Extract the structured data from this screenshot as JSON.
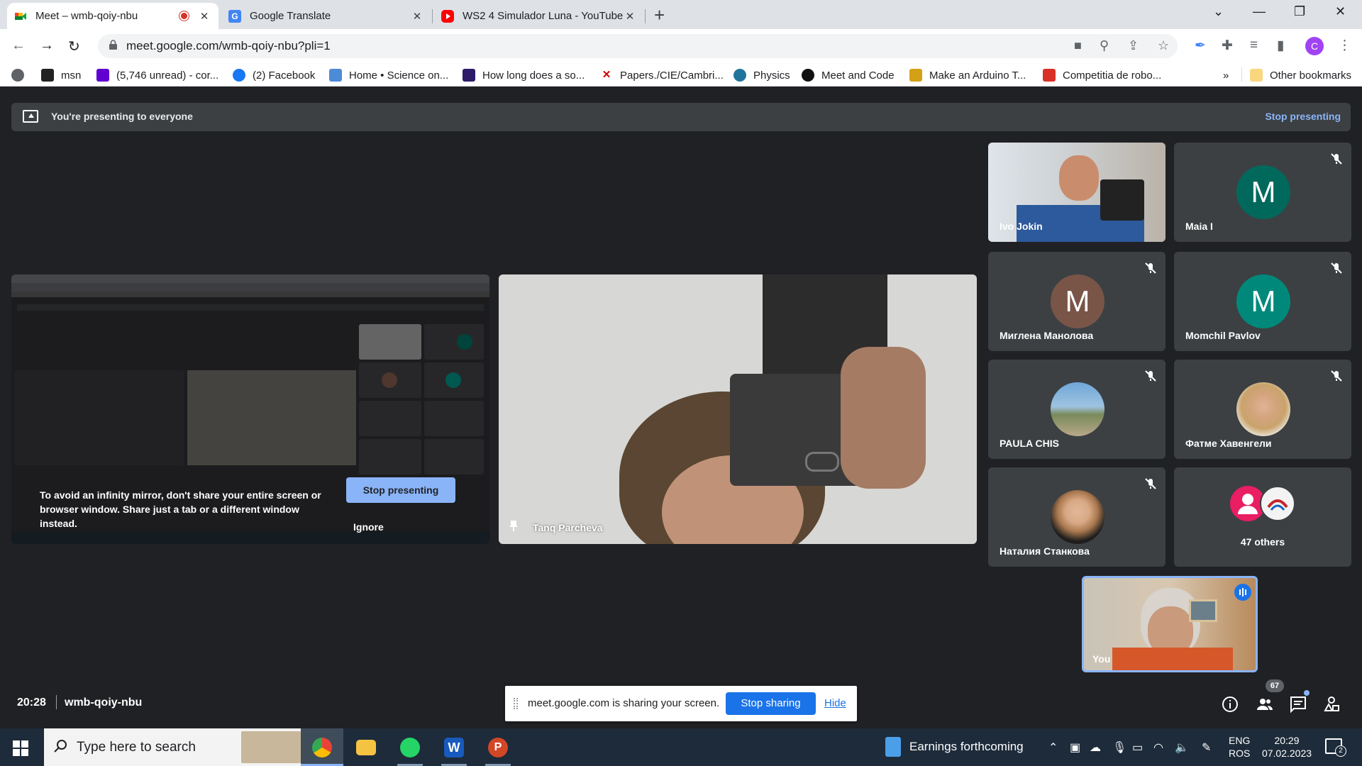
{
  "browser": {
    "tabs": [
      {
        "title": "Meet – wmb-qoiy-nbu",
        "icon": "google-meet-icon",
        "recording": true
      },
      {
        "title": "Google Translate",
        "icon": "google-translate-icon"
      },
      {
        "title": "WS2 4 Simulador Luna - YouTube",
        "icon": "youtube-icon"
      }
    ],
    "url": "meet.google.com/wmb-qoiy-nbu?pli=1",
    "profile_initial": "C",
    "bookmarks": [
      {
        "label": "msn",
        "icon": "msn-icon"
      },
      {
        "label": "(5,746 unread) - cor...",
        "icon": "yahoo-mail-icon"
      },
      {
        "label": "(2) Facebook",
        "icon": "facebook-icon"
      },
      {
        "label": "Home • Science on...",
        "icon": "bookmark-icon"
      },
      {
        "label": "How long does a so...",
        "icon": "bookmark-icon"
      },
      {
        "label": "Papers./CIE/Cambri...",
        "icon": "x-icon"
      },
      {
        "label": "Physics",
        "icon": "wordpress-icon"
      },
      {
        "label": "Meet and Code",
        "icon": "bookmark-icon"
      },
      {
        "label": "Make an Arduino T...",
        "icon": "bookmark-icon"
      },
      {
        "label": "Competitia de robo...",
        "icon": "bookmark-icon"
      }
    ],
    "overflow": "»",
    "other_bookmarks": "Other bookmarks"
  },
  "meet": {
    "banner_text": "You're presenting to everyone",
    "banner_stop": "Stop presenting",
    "mirror_warning": "To avoid an infinity mirror, don't share your entire screen or browser window. Share just a tab or a different window instead.",
    "mirror_stop": "Stop presenting",
    "mirror_ignore": "Ignore",
    "speaker_name": "Tanq Parcheva",
    "participants": [
      {
        "name": "Ivo Jokin",
        "type": "video"
      },
      {
        "name": "Maia I",
        "initial": "M",
        "color": "#00695c",
        "muted": true
      },
      {
        "name": "Миглена Манолова",
        "initial": "M",
        "color": "#795548",
        "muted": true
      },
      {
        "name": "Momchil Pavlov",
        "initial": "M",
        "color": "#00897b",
        "muted": true
      },
      {
        "name": "PAULA CHIS",
        "type": "photo",
        "muted": true
      },
      {
        "name": "Фатме Хавенгели",
        "type": "photo",
        "muted": true
      },
      {
        "name": "Наталия Станкова",
        "type": "photo",
        "muted": true
      }
    ],
    "others_label": "47 others",
    "self_label": "You",
    "time": "20:28",
    "meeting_code": "wmb-qoiy-nbu",
    "share_message": "meet.google.com is sharing your screen.",
    "share_stop": "Stop sharing",
    "share_hide": "Hide",
    "people_count": "67"
  },
  "taskbar": {
    "search_placeholder": "Type here to search",
    "news": "Earnings forthcoming",
    "lang_top": "ENG",
    "lang_bottom": "ROS",
    "time": "20:29",
    "date": "07.02.2023",
    "notification_count": "2",
    "apps": [
      "chrome-icon",
      "file-explorer-icon",
      "whatsapp-icon",
      "word-icon",
      "powerpoint-icon"
    ]
  },
  "colors": {
    "meet_bg": "#202124",
    "tile_bg": "#3c4043",
    "accent_blue": "#8ab4f8",
    "share_blue": "#1a73e8"
  }
}
